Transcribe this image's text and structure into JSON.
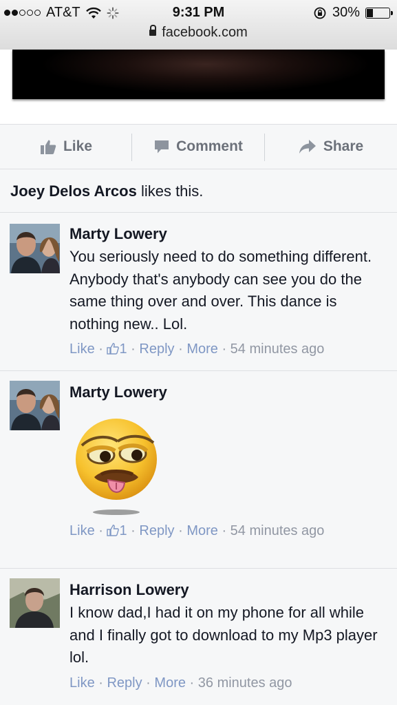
{
  "status_bar": {
    "carrier": "AT&T",
    "time": "9:31 PM",
    "battery": "30%",
    "battery_level": 0.3,
    "url": "facebook.com"
  },
  "actions": {
    "like": "Like",
    "comment": "Comment",
    "share": "Share"
  },
  "likes_line": {
    "name": "Joey Delos Arcos",
    "suffix": " likes this."
  },
  "comments": [
    {
      "author": "Marty Lowery",
      "text": "You seriously need to do something different. Anybody that's anybody can see you do the same thing over and over. This dance is nothing new.. Lol.",
      "like_label": "Like",
      "like_count": "1",
      "reply_label": "Reply",
      "more_label": "More",
      "time": "54 minutes ago"
    },
    {
      "author": "Marty Lowery",
      "sticker": "emoji-sticker",
      "like_label": "Like",
      "like_count": "1",
      "reply_label": "Reply",
      "more_label": "More",
      "time": "54 minutes ago"
    },
    {
      "author": "Harrison Lowery",
      "text": "I know dad,I had it on my phone for all while and I finally got to download to my Mp3 player lol.",
      "like_label": "Like",
      "reply_label": "Reply",
      "more_label": "More",
      "time": "36 minutes ago"
    }
  ],
  "colors": {
    "meta": "#9197a3",
    "link": "#7f97c4",
    "action": "#6c717a",
    "background": "#f6f7f8"
  }
}
